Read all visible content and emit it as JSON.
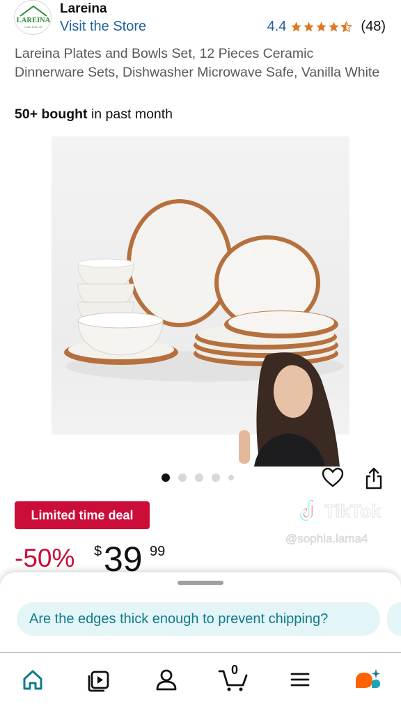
{
  "store": {
    "logo_text": "LAREINA",
    "logo_tagline": "Color Your Life",
    "name": "Lareina",
    "visit_label": "Visit the Store",
    "rating": "4.4",
    "stars": 4.4,
    "review_count": "(48)"
  },
  "product": {
    "title": "Lareina Plates and Bowls Set, 12 Pieces Ceramic Dinnerware Sets, Dishwasher Microwave Safe, Vanilla White",
    "bought_count": "50+ bought",
    "bought_suffix": " in past month"
  },
  "gallery": {
    "image_count": 5,
    "active_index": 0
  },
  "deal": {
    "badge": "Limited time deal",
    "discount": "-50%",
    "currency": "$",
    "price_whole": "39",
    "price_fraction": "99"
  },
  "overlay": {
    "brand": "TikTok",
    "username": "@sophia.lama4"
  },
  "suggestions": {
    "chip": "Are the edges thick enough to prevent chipping?"
  },
  "cart": {
    "count": "0"
  },
  "colors": {
    "link": "#2162a1",
    "deal": "#cc0c39",
    "star": "#de7921",
    "teal": "#117a8b",
    "chip_bg": "#e3f5f7"
  },
  "icons": {
    "nav": [
      "home-icon",
      "video-icon",
      "account-icon",
      "cart-icon",
      "menu-icon",
      "rufus-icon"
    ],
    "actions": [
      "heart-icon",
      "share-icon"
    ]
  }
}
